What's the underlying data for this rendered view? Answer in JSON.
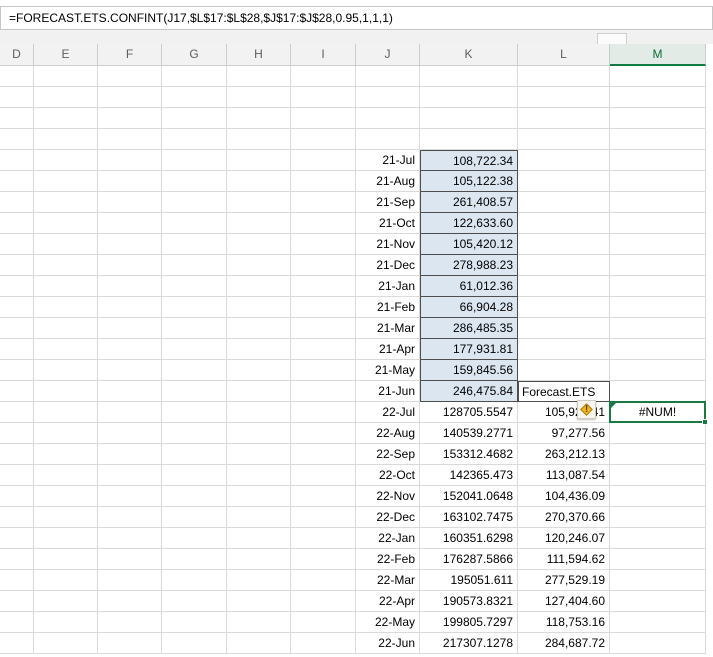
{
  "formula_bar": {
    "formula": "=FORECAST.ETS.CONFINT(J17,$L$17:$L$28,$J$17:$J$28,0.95,1,1,1)"
  },
  "column_headers": [
    "D",
    "E",
    "F",
    "G",
    "H",
    "I",
    "J",
    "K",
    "L",
    "M"
  ],
  "selected_column": "M",
  "actual": {
    "months": [
      "21-Jul",
      "21-Aug",
      "21-Sep",
      "21-Oct",
      "21-Nov",
      "21-Dec",
      "21-Jan",
      "21-Feb",
      "21-Mar",
      "21-Apr",
      "21-May",
      "21-Jun"
    ],
    "values": [
      "108,722.34",
      "105,122.38",
      "261,408.57",
      "122,633.60",
      "105,420.12",
      "278,988.23",
      "61,012.36",
      "66,904.28",
      "286,485.35",
      "177,931.81",
      "159,845.56",
      "246,475.84"
    ]
  },
  "forecast": {
    "label": "Forecast.ETS",
    "months": [
      "22-Jul",
      "22-Aug",
      "22-Sep",
      "22-Oct",
      "22-Nov",
      "22-Dec",
      "22-Jan",
      "22-Feb",
      "22-Mar",
      "22-Apr",
      "22-May",
      "22-Jun"
    ],
    "k_values": [
      "128705.5547",
      "140539.2771",
      "153312.4682",
      "142365.473",
      "152041.0648",
      "163102.7475",
      "160351.6298",
      "176287.5866",
      "195051.611",
      "190573.8321",
      "199805.7297",
      "217307.1278"
    ],
    "l_values": [
      "105,921.41",
      "97,277.56",
      "263,212.13",
      "113,087.54",
      "104,436.09",
      "270,370.66",
      "120,246.07",
      "111,594.62",
      "277,529.19",
      "127,404.60",
      "118,753.16",
      "284,687.72"
    ]
  },
  "error": {
    "value": "#NUM!",
    "icon_glyph": "!"
  },
  "colors": {
    "accent_green": "#107C41",
    "cell_fill_blue": "#dce6f1",
    "warning_yellow": "#f2b71e",
    "gridline_gray": "#dadada"
  }
}
